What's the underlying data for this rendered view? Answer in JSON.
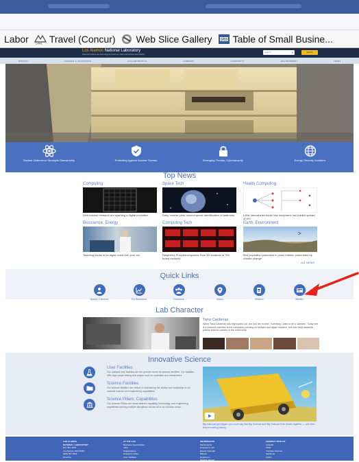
{
  "favorites": [
    {
      "label": "Labor",
      "icon": "none"
    },
    {
      "label": "Travel (Concur)",
      "icon": "lanl-logo-icon"
    },
    {
      "label": "Web Slice Gallery",
      "icon": "web-slice-icon"
    },
    {
      "label": "Table of Small Busine...",
      "icon": "sbs-icon"
    }
  ],
  "site": {
    "logo_part1": "Los Alamos",
    "logo_part2": "National Laboratory",
    "tagline": "Delivering science and technology to protect our nation and promote world stability",
    "search_placeholder": "Search",
    "search_button": "Search",
    "nav": [
      "MISSION",
      "SCIENCE & INNOVATION",
      "COLLABORATION",
      "CAREERS",
      "COMMUNITY",
      "ENVIRONMENT",
      "NEWS"
    ]
  },
  "band": [
    {
      "label": "Nuclear Deterrence Stockpile Stewardship",
      "icon": "atom-icon"
    },
    {
      "label": "Protecting Against Nuclear Threats",
      "icon": "shield-check-icon"
    },
    {
      "label": "Emerging Threats, Cybersecurity",
      "icon": "lock-icon"
    },
    {
      "label": "Energy Security Solutions",
      "icon": "globe-icon"
    }
  ],
  "top_news": {
    "title": "Top News",
    "items": [
      {
        "category": "Computing",
        "caption": "How nuclear research are sparking a digital revolution"
      },
      {
        "category": "Space Tech",
        "caption": "Early 'cosmic plots' could improve identification of asteroids"
      },
      {
        "category": "Health Computing",
        "caption": "LANL laboratories show how computers can predict spread of HIV"
      },
      {
        "category": "Bioscience, Energy",
        "caption": "Teaching plants to be algae could turn your car"
      },
      {
        "category": "Computing Tech",
        "caption": "Raspberry Pi supercomputers: from 3D students to 750 board modules"
      },
      {
        "category": "Earth, Environment",
        "caption": "Bird population plummets in pinon forests, plummeted by climate change"
      }
    ],
    "all_news": "ALL NEWS"
  },
  "quick_links": {
    "title": "Quick Links",
    "items": [
      {
        "label": "Apply: Careers",
        "icon": "person-icon"
      },
      {
        "label": "Do Business",
        "icon": "chart-icon"
      },
      {
        "label": "Contacts",
        "icon": "people-icon"
      },
      {
        "label": "Maps",
        "icon": "location-pin-icon"
      },
      {
        "label": "Visitors",
        "icon": "id-badge-icon"
      },
      {
        "label": "Media",
        "icon": "media-icon"
      }
    ]
  },
  "lab_character": {
    "title": "Lab Character",
    "name": "Tana Cardenas",
    "text": "When Tana Cardenas was eight years old, she told her mother, 'Someday I want to be a scientist.' Today she is a research scientist at the Laboratory working on biofuels and algae research, and she helps students pursue science careers in the community."
  },
  "innovative_science": {
    "title": "Innovative Science",
    "items": [
      {
        "title": "User Facilities",
        "text": "Our national user facilities are the premier home for science facilities. Our facilities offer high-range testing and unique tools for scientists and researchers.",
        "icon": "flask-icon"
      },
      {
        "title": "Science Facilities",
        "text": "Our science facilities are critical to maintaining the vitality and leadership of our national science and engineering capabilities.",
        "icon": "folder-icon"
      },
      {
        "title": "Science Pillars, Capabilities",
        "text": "Our Science Pillars are broad defined capability, technology, and engineering capabilities serving multiple disciplines across all of our mission areas.",
        "icon": "building-icon"
      }
    ],
    "caption": "Big data just got bigger: you could say that Big Science and Big Data put their heads together — and then they're making history."
  },
  "footer": [
    {
      "heading": "LOS ALAMOS",
      "lines": [
        "NATIONAL LABORATORY",
        "P.O. Box 1663",
        "Los Alamos, NM 87545",
        "(505) 667-5061",
        "Directory"
      ]
    },
    {
      "heading": "AT THE LAB",
      "lines": [
        "Business Opportunities",
        "Jobs",
        "Organizations",
        "Research Library",
        "User Facilities"
      ]
    },
    {
      "heading": "INFORMATION",
      "lines": [
        "Maintenance",
        "Emergency Info",
        "Events Calendar",
        "Mission",
        "Newsroom",
        "Weather Report"
      ]
    },
    {
      "heading": "CONNECT WITH US",
      "lines": [
        "LinkedIn",
        "Flickr",
        "YouTube Channel",
        "Facebook",
        "Twitter"
      ]
    }
  ],
  "colors": {
    "brand_blue": "#4a70c2",
    "header_dark": "#1f2d48",
    "logo_gold": "#f2b91e",
    "annotation_red": "#e8211a"
  }
}
